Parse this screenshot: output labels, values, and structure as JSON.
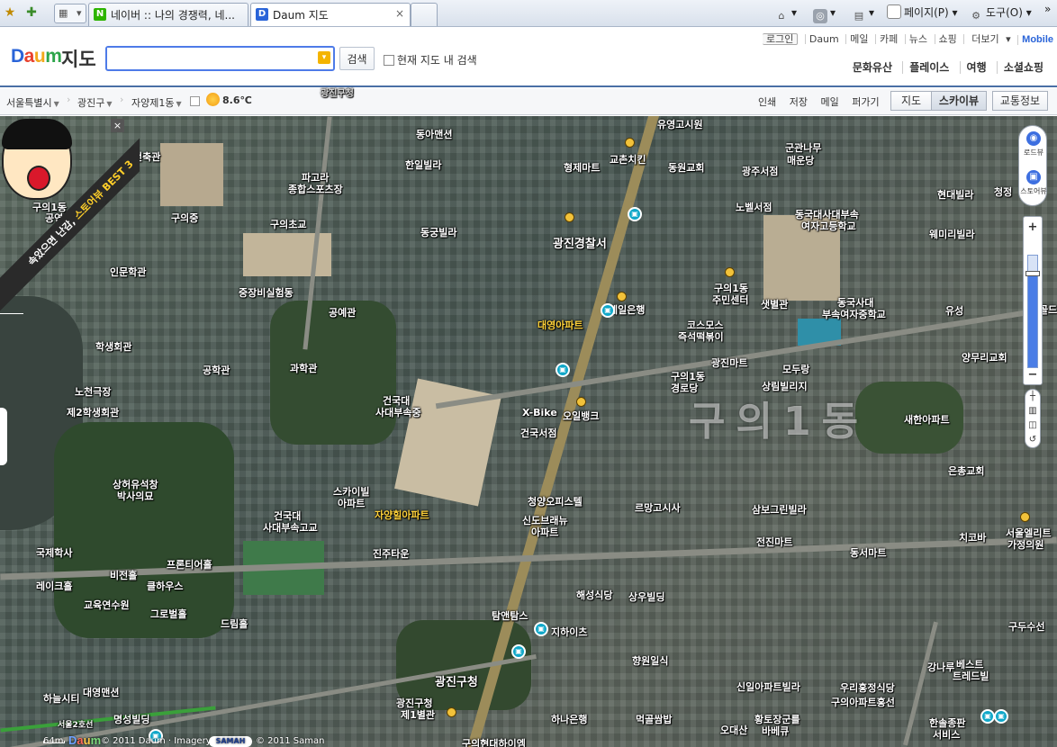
{
  "browser": {
    "tabs": [
      {
        "title": "네이버 :: 나의 경쟁력, 네...",
        "favicon": "naver-icon"
      },
      {
        "title": "Daum 지도",
        "favicon": "daum-icon"
      }
    ],
    "close_glyph": "×",
    "commands": {
      "page": "페이지(P)",
      "tools": "도구(O)"
    },
    "more_glyph": "»"
  },
  "header": {
    "logo": "Daum",
    "service": "지도",
    "search": {
      "value": "",
      "placeholder": "",
      "button": "검색"
    },
    "checkbox_label": "현재 지도 내 검색",
    "top_links": [
      "로그인",
      "Daum",
      "메일",
      "카페",
      "뉴스",
      "쇼핑",
      "더보기",
      "Mobile"
    ],
    "service_links": [
      "문화유산",
      "플레이스",
      "여행",
      "소셜쇼핑"
    ]
  },
  "toolbar": {
    "location": [
      "서울특별시",
      "광진구",
      "자양제1동"
    ],
    "temperature": "8.6℃",
    "tools": [
      "인쇄",
      "저장",
      "메일",
      "퍼가기"
    ],
    "map_types": [
      "지도",
      "스카이뷰",
      "교통정보"
    ],
    "selected_map_type": "스카이뷰",
    "overlay_top_label": "광진구청"
  },
  "promo": {
    "ribbon_prefix": "속았으면 난감,",
    "ribbon_highlight": "스토어뷰 BEST 3",
    "close": "×"
  },
  "controls": {
    "roadview": "로드뷰",
    "storeview": "스토어뷰",
    "zoom_in": "+",
    "zoom_out": "−",
    "zoom_level_fraction": 0.84
  },
  "map": {
    "dong_label": "구의1동",
    "labels": [
      "유영고시원",
      "동아맨션",
      "교촌치킨",
      "동원교회",
      "광주서점",
      "군관나무",
      "매운당",
      "청정",
      "현대빌라",
      "건축관",
      "파고라",
      "종합스포츠장",
      "한일빌라",
      "형제마트",
      "노벨서점",
      "동국대사대부속",
      "여자고등학교",
      "구의1동",
      "공연장",
      "구의중",
      "구의초교",
      "동궁빌라",
      "광진경찰서",
      "웨미리빌라",
      "인문학관",
      "중장비실험동",
      "구의1동",
      "주민센터",
      "샛별관",
      "동국사대",
      "부속여자중학교",
      "유성",
      "공예관",
      "대영아파트",
      "제일은행",
      "코스모스",
      "즉석떡볶이",
      "골드",
      "학생회관",
      "노천극장",
      "제2학생회관",
      "공학관",
      "과학관",
      "광진마트",
      "모두랑",
      "양무리교회",
      "구의1동",
      "경로당",
      "상림빌리지",
      "새한아파트",
      "건국대",
      "사대부속중",
      "X-Bike",
      "오일뱅크",
      "건국서점",
      "은총교회",
      "상허유석창",
      "박사의묘",
      "스카이빌",
      "아파트",
      "청양오피스텔",
      "르망고시사",
      "삼보그린빌라",
      "건국대",
      "사대부속고교",
      "자양힐아파트",
      "신도브래뉴",
      "아파트",
      "서울엘리트",
      "가정의원",
      "국제학사",
      "진주타운",
      "전진마트",
      "동서마트",
      "치코바",
      "비전홀",
      "프론티어홀",
      "레이크홀",
      "클하우스",
      "교육연수원",
      "해성식당",
      "상우빌딩",
      "그로벌홀",
      "드림홀",
      "탐앤탐스",
      "지하이츠",
      "구두수선",
      "향원일식",
      "강나루",
      "베스트",
      "트레드빌",
      "광진구청",
      "대영맨션",
      "하늘시티",
      "우리홍정식당",
      "신일아파트빌라",
      "구의아파트홍선",
      "명성빌딩",
      "광진구청",
      "제1별관",
      "먹골쌈밥",
      "하나은행",
      "오대산",
      "황토장군를",
      "바베큐",
      "한솔종판",
      "서비스",
      "서울2호선",
      "구의현대하이엠"
    ]
  },
  "footer": {
    "scale": "64m",
    "logo": "Daum",
    "copyright1": "© 2011 Daum · Imagery",
    "samah": "SAMAH",
    "copyright2": "© 2011 Saman"
  }
}
